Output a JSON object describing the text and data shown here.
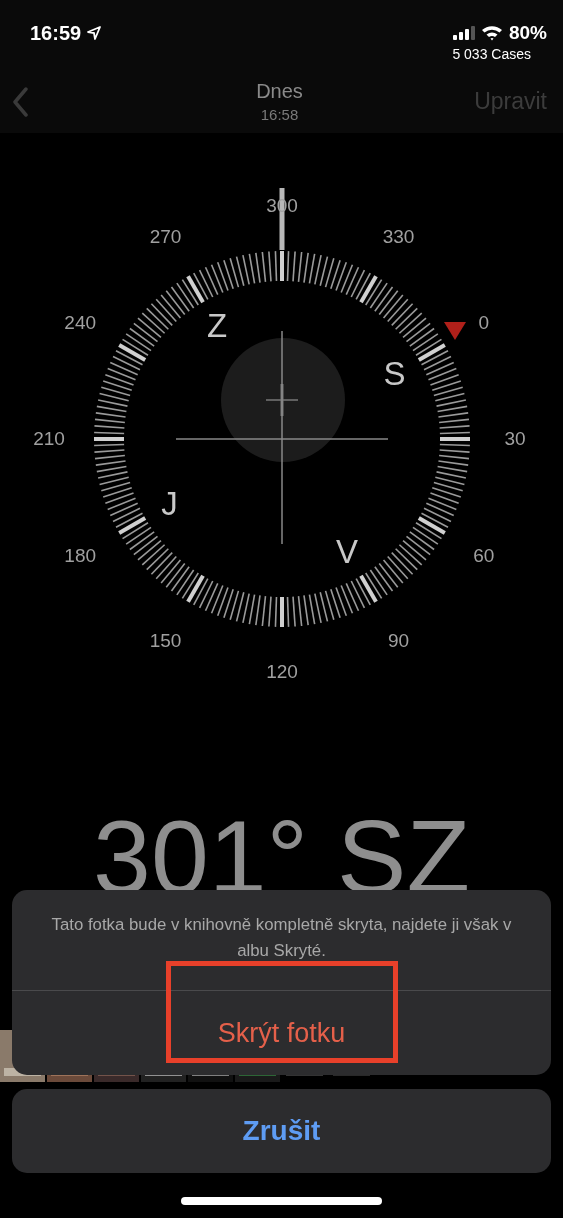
{
  "status_bar": {
    "time": "16:59",
    "battery": "80%",
    "carrier_note": "5 033 Cases"
  },
  "nav_bar": {
    "title": "Dnes",
    "subtitle": "16:58",
    "edit": {
      "label": "Upravit",
      "disabled": true
    }
  },
  "compass": {
    "degree_labels": [
      "0",
      "30",
      "60",
      "90",
      "120",
      "150",
      "180",
      "210",
      "240",
      "270",
      "300",
      "330"
    ],
    "cardinal_labels": [
      "S",
      "V",
      "J",
      "Z"
    ],
    "heading": "301° SZ"
  },
  "action_sheet": {
    "message": "Tato fotka bude v knihovně kompletně skryta, najdete ji však v albu Skryté.",
    "action": {
      "label": "Skrýt fotku",
      "highlighted": true
    },
    "cancel": "Zrušit"
  }
}
